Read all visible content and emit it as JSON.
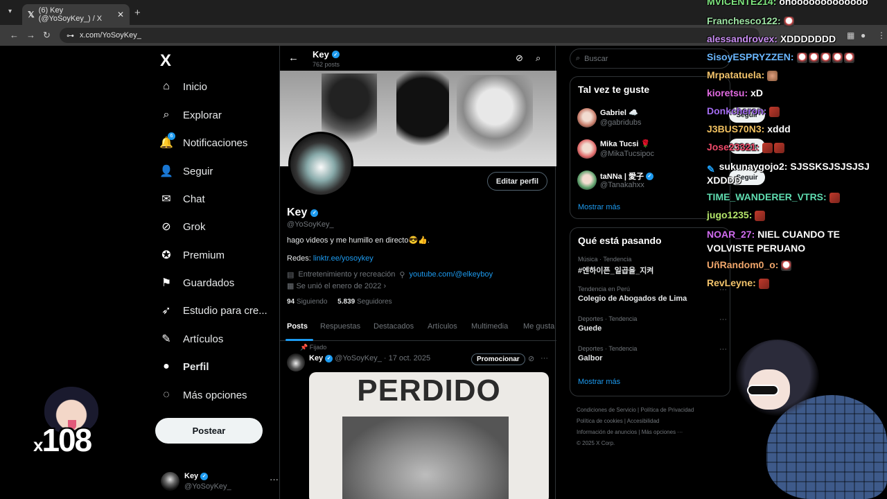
{
  "browser": {
    "tab_title": "(6) Key (@YoSoyKey_) / X",
    "url": "x.com/YoSoyKey_"
  },
  "sidebar": {
    "logo": "X",
    "items": [
      {
        "label": "Inicio",
        "icon": "home-icon"
      },
      {
        "label": "Explorar",
        "icon": "search-icon"
      },
      {
        "label": "Notificaciones",
        "icon": "bell-icon",
        "badge": "6"
      },
      {
        "label": "Seguir",
        "icon": "add-person-icon"
      },
      {
        "label": "Chat",
        "icon": "mail-icon"
      },
      {
        "label": "Grok",
        "icon": "grok-icon"
      },
      {
        "label": "Premium",
        "icon": "premium-icon"
      },
      {
        "label": "Guardados",
        "icon": "bookmark-icon"
      },
      {
        "label": "Estudio para cre...",
        "icon": "rocket-icon"
      },
      {
        "label": "Artículos",
        "icon": "article-icon"
      },
      {
        "label": "Perfil",
        "icon": "person-icon"
      },
      {
        "label": "Más opciones",
        "icon": "more-circle-icon"
      }
    ],
    "post_button": "Postear",
    "account": {
      "name": "Key",
      "handle": "@YoSoyKey_",
      "more": "···"
    }
  },
  "profile_header": {
    "name": "Key",
    "posts": "762 posts"
  },
  "profile": {
    "edit_button": "Editar perfil",
    "name": "Key",
    "handle": "@YoSoyKey_",
    "bio": "hago videos y me humillo en directo😎👍.",
    "links_label": "Redes:",
    "links_url": "linktr.ee/yosoykey",
    "category": "Entretenimiento y recreación",
    "website": "youtube.com/@elkeyboy",
    "joined": "Se unió el enero de 2022",
    "following_count": "94",
    "following_label": "Siguiendo",
    "followers_count": "5.839",
    "followers_label": "Seguidores"
  },
  "tabs": [
    "Posts",
    "Respuestas",
    "Destacados",
    "Artículos",
    "Multimedia",
    "Me gusta"
  ],
  "tweet": {
    "pinned": "Fijado",
    "name": "Key",
    "handle_date": "@YoSoyKey_ · 17 oct. 2025",
    "promote": "Promocionar",
    "image_text": "PERDIDO"
  },
  "right": {
    "search_placeholder": "Buscar",
    "suggest_title": "Tal vez te guste",
    "suggestions": [
      {
        "name": "Gabriel ☁️",
        "handle": "@gabridubs",
        "button": "Seguir",
        "color": "#c77d6b"
      },
      {
        "name": "Mika Tucsi 🌹",
        "handle": "@MikaTucsipoc",
        "button": "Seguir",
        "color": "#e06a6a"
      },
      {
        "name": "taNNa | 愛子",
        "handle": "@Tanakahxx",
        "button": "Seguir",
        "color": "#5c9f6b"
      }
    ],
    "show_more": "Mostrar más",
    "trends_title": "Qué está pasando",
    "trends": [
      {
        "category": "Música · Tendencia",
        "name": "#엔하이픈_일곱을_지켜"
      },
      {
        "category": "Tendencia en Perú",
        "name": "Colegio de Abogados de Lima"
      },
      {
        "category": "Deportes · Tendencia",
        "name": "Guede"
      },
      {
        "category": "Deportes · Tendencia",
        "name": "Galbor"
      }
    ],
    "trends_show_more": "Mostrar más",
    "footer": [
      "Condiciones de Servicio",
      "Política de Privacidad",
      "Política de cookies",
      "Accesibilidad",
      "Información de anuncios",
      "Más opciones ···",
      "© 2025 X Corp."
    ]
  },
  "chat": [
    {
      "user": "MVICENTE214:",
      "text": "ohooooooooooooo",
      "color": "#7fe67f",
      "emotes": []
    },
    {
      "user": "Franchesco122:",
      "text": "",
      "color": "#9fe5a5",
      "emotes": [
        "ghost"
      ]
    },
    {
      "user": "alessandrovex:",
      "text": "XDDDDDDD",
      "color": "#c98ef2",
      "emotes": []
    },
    {
      "user": "SisoyESPRYZZEN:",
      "text": "",
      "color": "#6ab7ff",
      "emotes": [
        "ghost",
        "ghost",
        "ghost",
        "ghost",
        "ghost"
      ]
    },
    {
      "user": "Mrpatatuela:",
      "text": "",
      "color": "#f2c36b",
      "emotes": [
        "hand"
      ]
    },
    {
      "user": "kioretsu:",
      "text": "xD",
      "color": "#e06ae0",
      "emotes": []
    },
    {
      "user": "Donkcheron:",
      "text": "",
      "color": "#a36cf0",
      "emotes": [
        "red"
      ]
    },
    {
      "user": "J3BUS70N3:",
      "text": "xddd",
      "color": "#f0c060",
      "emotes": []
    },
    {
      "user": "Jose23321:",
      "text": "",
      "color": "#f04a6a",
      "emotes": [
        "red",
        "red"
      ]
    },
    {
      "user": "sukunaygojo2:",
      "text": "SJSSKSJSJSJSJ XDDDD",
      "color": "#ffffff",
      "emotes": [
        "pin"
      ]
    },
    {
      "user": "TIME_WANDERER_VTRS:",
      "text": "",
      "color": "#5fdcb0",
      "emotes": [
        "red"
      ]
    },
    {
      "user": "jugo1235:",
      "text": "",
      "color": "#b5e66b",
      "emotes": [
        "red"
      ]
    },
    {
      "user": "NOAR_27:",
      "text": "NIEL CUANDO TE VOLVISTE PERUANO",
      "color": "#d16cf0",
      "emotes": []
    },
    {
      "user": "UñRandom0_o:",
      "text": "",
      "color": "#f0a66b",
      "emotes": [
        "ghost"
      ]
    },
    {
      "user": "RevLeyne:",
      "text": "",
      "color": "#f2c36b",
      "emotes": [
        "red"
      ]
    }
  ],
  "combo": {
    "counter": "108",
    "prefix": "x"
  }
}
